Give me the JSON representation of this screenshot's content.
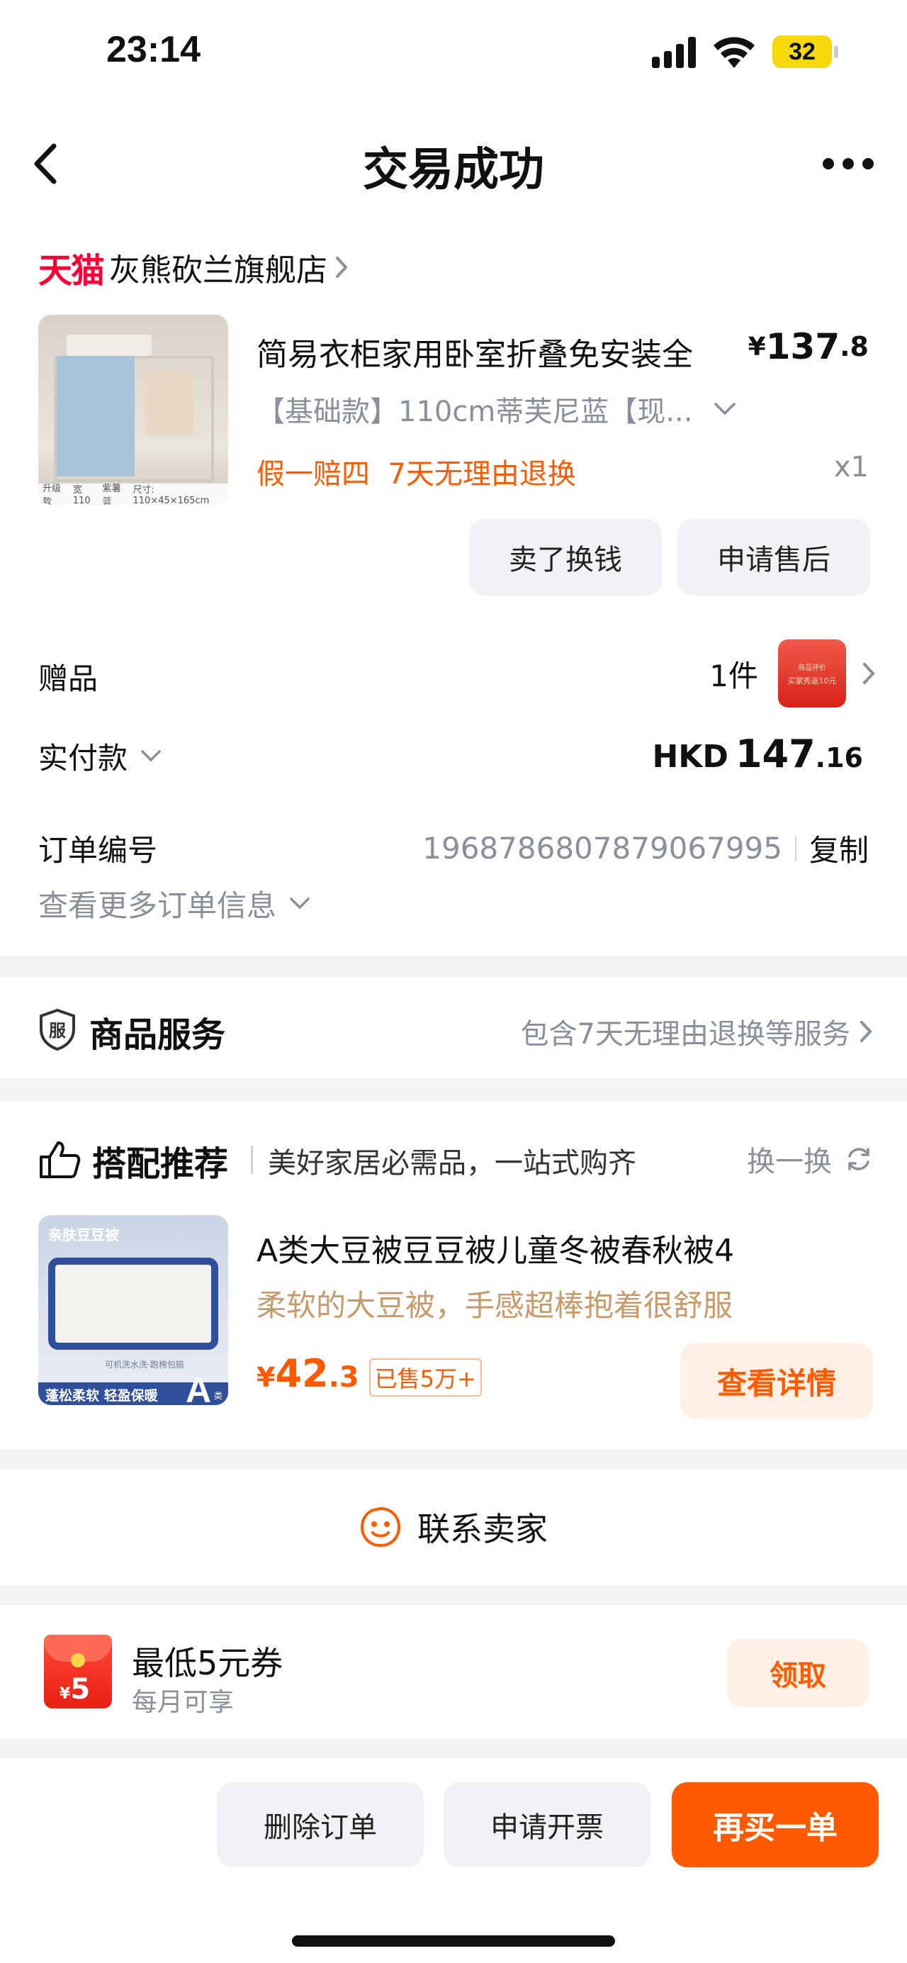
{
  "status_bar": {
    "time": "23:14",
    "battery": "32"
  },
  "header": {
    "title": "交易成功"
  },
  "store": {
    "brand": "天猫",
    "name": "灰熊砍兰旗舰店"
  },
  "product": {
    "title": "简易衣柜家用卧室折叠免安装全",
    "price_symbol": "¥",
    "price_int": "137",
    "price_dec": ".8",
    "spec": "【基础款】110cm蒂芙尼蓝【现...",
    "tags": "假一赔四  7天无理由退换",
    "qty": "x1",
    "thumb_label_1": "升级款",
    "thumb_label_2": "宽110",
    "thumb_label_3": "紫薯蓝",
    "thumb_label_4": "尺寸: 110×45×165cm"
  },
  "product_actions": {
    "sell": "卖了换钱",
    "after_sale": "申请售后"
  },
  "gift": {
    "label": "赠品",
    "count": "1件",
    "icon_text_1": "商品评价",
    "icon_text_2": "买家秀返10元"
  },
  "payment": {
    "label": "实付款",
    "currency": "HKD",
    "amount_int": "147",
    "amount_dec": ".16"
  },
  "order": {
    "id_label": "订单编号",
    "id_value": "1968786807879067995",
    "copy": "复制",
    "more": "查看更多订单信息"
  },
  "service": {
    "icon_char": "服",
    "title": "商品服务",
    "desc": "包含7天无理由退换等服务"
  },
  "recommend": {
    "title": "搭配推荐",
    "subtitle": "美好家居必需品，一站式购齐",
    "refresh": "换一换",
    "item": {
      "title": "A类大豆被豆豆被儿童冬被春秋被4",
      "desc": "柔软的大豆被，手感超棒抱着很舒服",
      "price_symbol": "¥",
      "price_int": "42",
      "price_dec": ".3",
      "sold": "已售5万+",
      "button": "查看详情",
      "thumb_top": "亲肤豆豆被",
      "thumb_mid": "可机洗水洗·跑棉包赔",
      "thumb_bottom": "蓬松柔软 轻盈保暖",
      "thumb_grade": "A",
      "thumb_grade_sub": "类"
    }
  },
  "contact": {
    "label": "联系卖家"
  },
  "coupon": {
    "amount_symbol": "¥",
    "amount": "5",
    "title": "最低5元券",
    "subtitle": "每月可享",
    "button": "领取"
  },
  "bottom_bar": {
    "delete": "删除订单",
    "invoice": "申请开票",
    "rebuy": "再买一单"
  },
  "colors": {
    "accent": "#ff5a00",
    "tmall_red": "#ff0036",
    "teal_icon": "#6a7480"
  }
}
